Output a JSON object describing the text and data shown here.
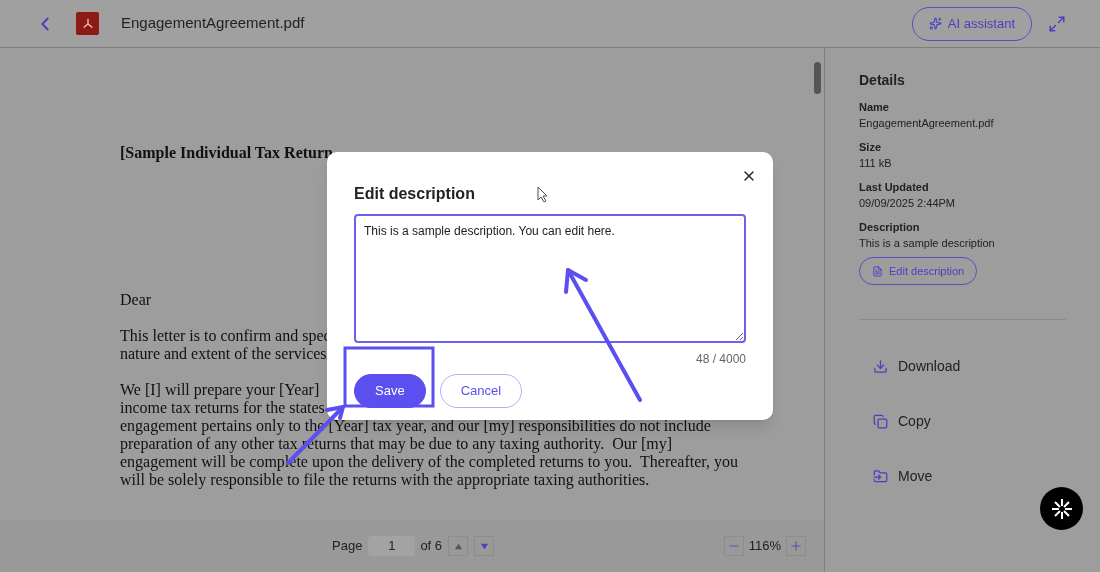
{
  "header": {
    "file_name": "EngagementAgreement.pdf",
    "ai_button": "AI assistant"
  },
  "document": {
    "heading": "[Sample Individual Tax Return",
    "salutation": "Dear",
    "paragraphs": [
      [
        "This letter is to confirm and spec",
        "nature and extent of the services"
      ],
      [
        "We [I] will prepare your [Year] ",
        "income tax returns for the states",
        "engagement pertains only to the [Year] tax year, and our [my] responsibilities do not include",
        "preparation of any other tax returns that may be due to any taxing authority.  Our [my]",
        "engagement will be complete upon the delivery of the completed returns to you.  Thereafter, you",
        "will be solely responsible to file the returns with the appropriate taxing authorities."
      ]
    ]
  },
  "pager": {
    "label": "Page",
    "page": "1",
    "of": "of 6",
    "zoom": "116%"
  },
  "details": {
    "title": "Details",
    "fields": [
      {
        "label": "Name",
        "value": "EngagementAgreement.pdf"
      },
      {
        "label": "Size",
        "value": "111 kB"
      },
      {
        "label": "Last Updated",
        "value": "09/09/2025 2:44PM"
      },
      {
        "label": "Description",
        "value": "This is a sample description"
      }
    ],
    "edit_button": "Edit description",
    "actions": [
      {
        "kind": "download",
        "label": "Download"
      },
      {
        "kind": "copy",
        "label": "Copy"
      },
      {
        "kind": "move",
        "label": "Move"
      }
    ]
  },
  "dialog": {
    "title": "Edit description",
    "value": "This is a sample description. You can edit here.",
    "counter": "48 / 4000",
    "buttons": [
      {
        "kind": "primary",
        "label": "Save"
      },
      {
        "kind": "secondary",
        "label": "Cancel"
      }
    ]
  }
}
